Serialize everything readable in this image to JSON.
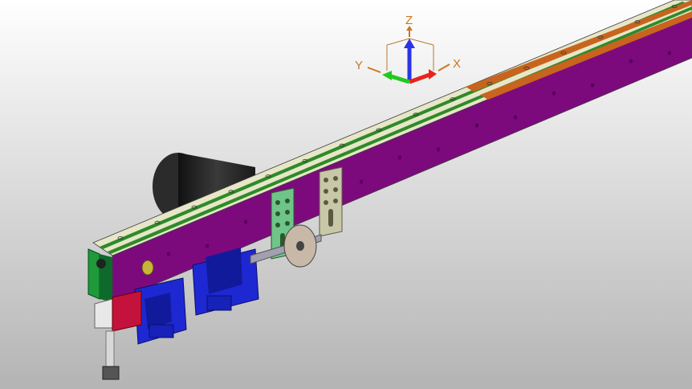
{
  "viewport": {
    "background_top": "#ffffff",
    "background_bottom": "#b4b4b4"
  },
  "triad": {
    "x_label": "X",
    "y_label": "Y",
    "z_label": "Z",
    "x_color": "#e8241c",
    "y_color": "#22c81e",
    "z_color": "#2a34e6",
    "label_color": "#c87820",
    "frame_color": "#b87830"
  },
  "model": {
    "rail_color": "#7d0a7d",
    "rail_top_color": "#e7e6c8",
    "rail_edge_color": "#3c3c3c",
    "groove_color": "#2e8a2a",
    "strip_color": "#c8641e",
    "motor_color": "#2b2b2b",
    "bracket_color": "#6fc48a",
    "bracket_alt_color": "#c8c8a8",
    "mount_color": "#1e28d2",
    "end_block_color": "#c3133c",
    "end_plate_color": "#1e9a3a",
    "wheel_color": "#c8b8a8",
    "rod_color": "#d8d8d8",
    "hole_color": "#5a005a"
  }
}
